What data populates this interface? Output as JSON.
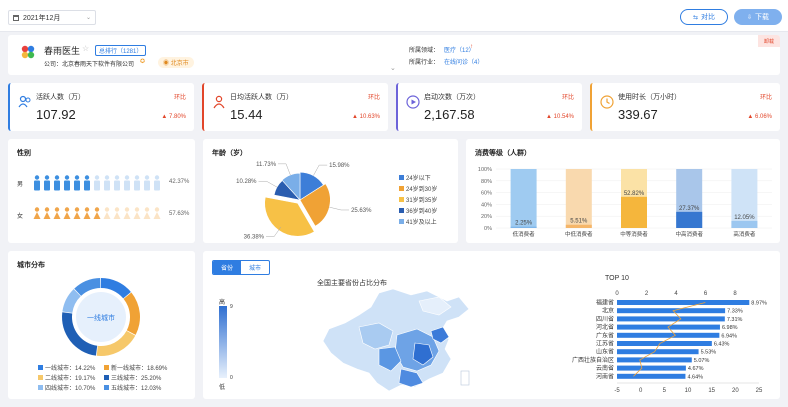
{
  "header": {
    "date": "2021年12月",
    "compare_label": "对比",
    "download_label": "下载"
  },
  "app": {
    "name": "春雨医生",
    "rank_label": "总排行（1281）",
    "company_label": "公司：",
    "company": "北京春雨天下软件有限公司",
    "location": "北京市",
    "field_label": "所属领域：",
    "field_value": "医疗（12）",
    "industry_label": "所属行业：",
    "industry_value": "在线问诊（4）",
    "corner_tag": "卸载"
  },
  "metrics": [
    {
      "title": "活跃人数（万）",
      "value": "107.92",
      "change_label": "环比",
      "change": "7.80%",
      "icon": "users-icon"
    },
    {
      "title": "日均活跃人数（万）",
      "value": "15.44",
      "change_label": "环比",
      "change": "10.63%",
      "icon": "user-icon"
    },
    {
      "title": "启动次数（万次）",
      "value": "2,167.58",
      "change_label": "环比",
      "change": "10.54%",
      "icon": "play-icon"
    },
    {
      "title": "使用时长（万小时）",
      "value": "339.67",
      "change_label": "环比",
      "change": "6.06%",
      "icon": "clock-icon"
    }
  ],
  "gender": {
    "title": "性别",
    "rows": [
      {
        "label": "男",
        "value": "42.37%",
        "share": 0.4237,
        "color": "#3d8fe0",
        "light": "#cfe2f6"
      },
      {
        "label": "女",
        "value": "57.63%",
        "share": 0.5763,
        "color": "#f0a54a",
        "light": "#fbe4c6"
      }
    ]
  },
  "age": {
    "title": "年龄（岁）",
    "chart_data": {
      "type": "pie",
      "title": "年龄（岁）",
      "categories": [
        "24岁以下",
        "24岁到30岁",
        "31岁到35岁",
        "36岁到40岁",
        "41岁及以上"
      ],
      "values": [
        15.98,
        25.63,
        36.38,
        10.28,
        11.73
      ],
      "colors": [
        "#3d7ed8",
        "#f0a235",
        "#f7c146",
        "#2a5db0",
        "#7aaee8"
      ]
    }
  },
  "consumption": {
    "title": "消费等级（人群）",
    "chart_data": {
      "type": "bar",
      "title": "消费等级（人群）",
      "categories": [
        "低消费者",
        "中低消费者",
        "中等消费者",
        "中高消费者",
        "高消费者"
      ],
      "values": [
        2.25,
        5.51,
        52.82,
        27.37,
        12.05
      ],
      "value_labels": [
        "2.25%",
        "5.51%",
        "52.82%",
        "27.37%",
        "12.05%"
      ],
      "ylim": [
        0,
        100
      ],
      "yticks": [
        "0%",
        "20%",
        "40%",
        "60%",
        "80%",
        "100%"
      ],
      "fg_colors": [
        "#7fb6ea",
        "#f5b66a",
        "#f5b63c",
        "#3677d0",
        "#9cc7f0"
      ],
      "bg_colors": [
        "#9fcbf1",
        "#f9d9ae",
        "#fbe2a6",
        "#a9c6ea",
        "#cfe3f7"
      ]
    }
  },
  "city": {
    "title": "城市分布",
    "center_label": "一线城市",
    "chart_data": {
      "type": "pie",
      "categories": [
        "一线城市",
        "新一线城市",
        "二线城市",
        "三线城市",
        "四线城市",
        "五线城市"
      ],
      "values": [
        14.22,
        18.69,
        19.17,
        25.2,
        10.7,
        12.03
      ],
      "labels": [
        "14.22%",
        "18.69%",
        "19.17%",
        "25.20%",
        "10.70%",
        "12.03%"
      ],
      "colors": [
        "#2f7de1",
        "#f0a235",
        "#f6c86a",
        "#1f5fb5",
        "#8fbdf0",
        "#4a90e2"
      ]
    }
  },
  "map": {
    "tabs": [
      "省份",
      "城市"
    ],
    "title": "全国主要省份占比分布",
    "legend_high": "高",
    "legend_low": "低",
    "legend_max": "9",
    "legend_min": "0"
  },
  "top10": {
    "title": "TOP 10",
    "chart_data": {
      "type": "bar",
      "title": "TOP 10",
      "categories": [
        "福建省",
        "北京",
        "四川省",
        "河北省",
        "广东省",
        "江苏省",
        "山东省",
        "广西壮族自治区",
        "云南省",
        "河南省"
      ],
      "values": [
        8.97,
        7.33,
        7.31,
        6.98,
        6.94,
        6.43,
        5.53,
        5.07,
        4.67,
        4.64
      ],
      "labels": [
        "8.97%",
        "7.33%",
        "7.31%",
        "6.98%",
        "6.94%",
        "6.43%",
        "5.53%",
        "5.07%",
        "4.67%",
        "4.64%"
      ],
      "top_ticks": [
        "0",
        "2",
        "4",
        "6",
        "8"
      ],
      "bottom_ticks": [
        "-5",
        "0",
        "5",
        "10",
        "15",
        "20",
        "25"
      ]
    }
  }
}
